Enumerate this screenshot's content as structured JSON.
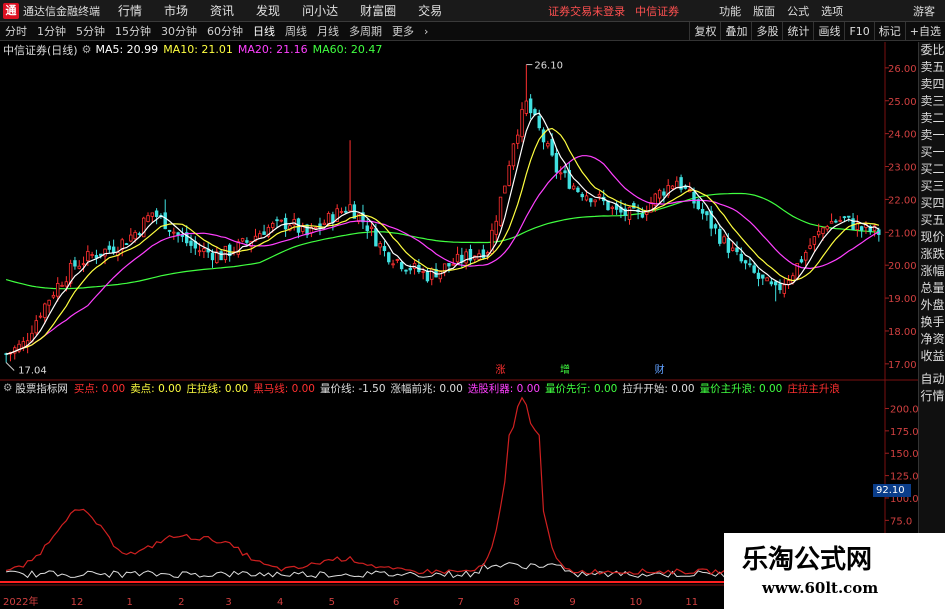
{
  "app": {
    "logo_glyph": "通",
    "title": "通达信金融终端"
  },
  "menu": [
    "行情",
    "市场",
    "资讯",
    "发现",
    "问小达",
    "财富圈",
    "交易"
  ],
  "login_status": "证券交易未登录",
  "broker": "中信证券",
  "right_menu": [
    "功能",
    "版面",
    "公式",
    "选项"
  ],
  "guest": "游客",
  "periods": [
    "分时",
    "1分钟",
    "5分钟",
    "15分钟",
    "30分钟",
    "60分钟",
    "日线",
    "周线",
    "月线",
    "多周期",
    "更多"
  ],
  "active_period": "日线",
  "tools": [
    "复权",
    "叠加",
    "多股",
    "统计",
    "画线",
    "F10",
    "标记",
    "+自选"
  ],
  "chart_info": {
    "stock": "中信证券(日线)",
    "ma5": "MA5: 20.99",
    "ma10": "MA10: 21.01",
    "ma20": "MA20: 21.16",
    "ma60": "MA60: 20.47"
  },
  "side_tabs": [
    "委比",
    "卖五",
    "卖四",
    "卖三",
    "卖二",
    "卖一",
    "买一",
    "买二",
    "买三",
    "买四",
    "买五",
    "现价",
    "涨跌",
    "涨幅",
    "总量",
    "外盘",
    "换手",
    "净资",
    "收益",
    "自动",
    "行情"
  ],
  "indicator": {
    "name": "股票指标网",
    "items": [
      {
        "text": "买点: 0.00",
        "color": "#ff3030"
      },
      {
        "text": "卖点: 0.00",
        "color": "#ffff40"
      },
      {
        "text": "庄拉线: 0.00",
        "color": "#ffff40"
      },
      {
        "text": "黑马线: 0.00",
        "color": "#ff3030"
      },
      {
        "text": "量价线: -1.50",
        "color": "#dddddd"
      },
      {
        "text": "涨幅前兆: 0.00",
        "color": "#dddddd"
      },
      {
        "text": "选股利器: 0.00",
        "color": "#ff40ff"
      },
      {
        "text": "量价先行: 0.00",
        "color": "#40ff40"
      },
      {
        "text": "拉升开始: 0.00",
        "color": "#dddddd"
      },
      {
        "text": "量价主升浪: 0.00",
        "color": "#40ff40"
      },
      {
        "text": "庄拉主升浪",
        "color": "#ff3030"
      }
    ]
  },
  "markers": {
    "high": "26.10",
    "low": "17.04",
    "signals": [
      {
        "text": "涨",
        "color": "#ff3030"
      },
      {
        "text": "增",
        "color": "#40ff40"
      },
      {
        "text": "财",
        "color": "#60a0ff"
      }
    ]
  },
  "price_axis": [
    "26.00",
    "25.00",
    "24.00",
    "23.00",
    "22.00",
    "21.00",
    "20.00",
    "19.00",
    "18.00",
    "17.00"
  ],
  "indicator_axis": [
    "200.0",
    "175.0",
    "150.0",
    "125.0",
    "100.0",
    "75.0",
    "50.0"
  ],
  "cursor_value": "92.10",
  "date_axis": [
    "2022年",
    "12",
    "1",
    "2",
    "3",
    "4",
    "5",
    "6",
    "7",
    "8",
    "9",
    "10",
    "11",
    "12"
  ],
  "colors": {
    "ma5": "#ffffff",
    "ma10": "#ffff40",
    "ma20": "#ff40ff",
    "ma60": "#40ff40",
    "up": "#ff3030",
    "down": "#40e0e0"
  },
  "watermark": {
    "title": "乐淘公式网",
    "url": "www.60lt.com"
  }
}
